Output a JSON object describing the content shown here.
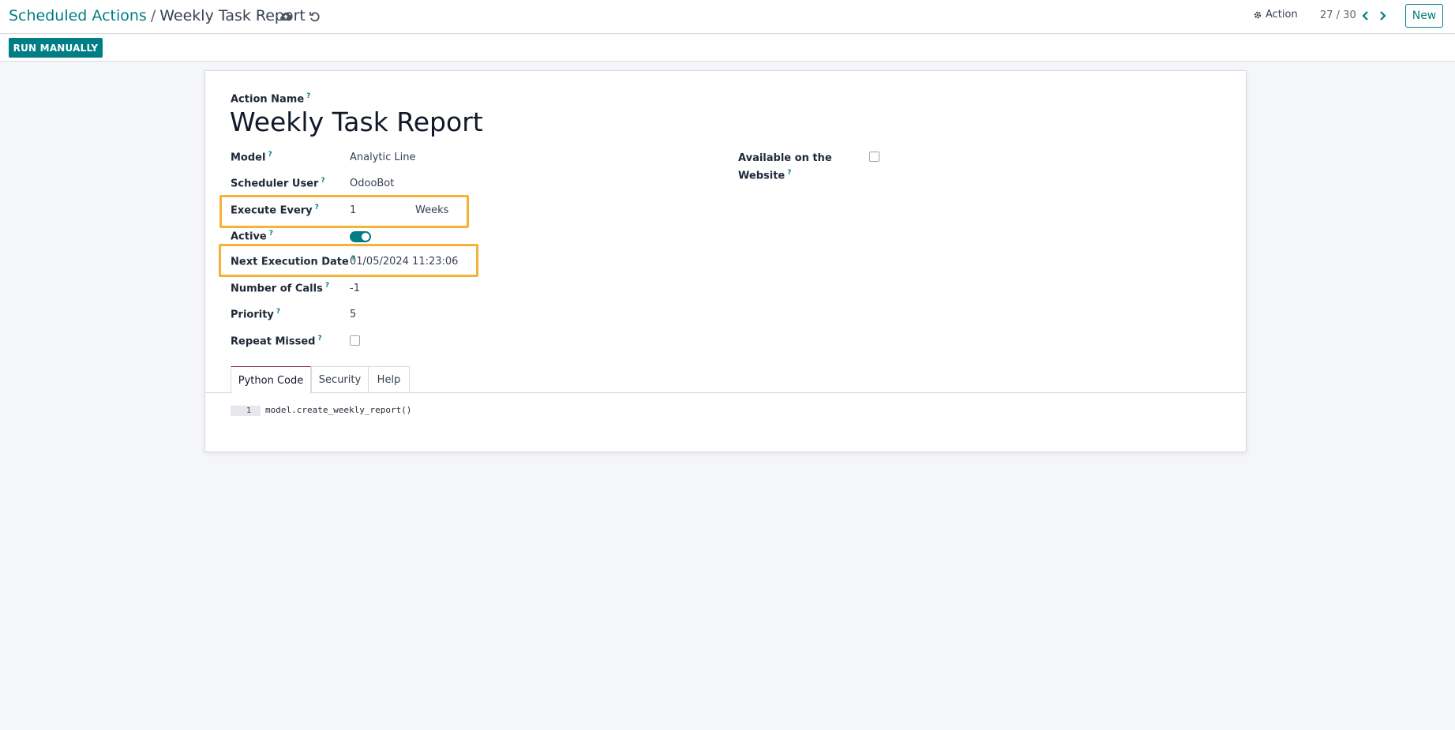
{
  "breadcrumb": {
    "parent": "Scheduled Actions",
    "separator": "/",
    "current": "Weekly Task Report"
  },
  "toolbar": {
    "save_icon": "cloud-upload-icon",
    "discard_icon": "undo-icon",
    "action_label": "Action",
    "action_icon": "gear-icon",
    "pager": "27 / 30",
    "new_label": "New"
  },
  "statusbar": {
    "run_label": "RUN MANUALLY"
  },
  "form": {
    "action_name_label": "Action Name",
    "title": "Weekly Task Report",
    "fields": {
      "model": {
        "label": "Model",
        "value": "Analytic Line"
      },
      "scheduler_user": {
        "label": "Scheduler User",
        "value": "OdooBot"
      },
      "execute_every": {
        "label": "Execute Every",
        "value": "1",
        "unit": "Weeks"
      },
      "active": {
        "label": "Active",
        "value": true
      },
      "next_execution_date": {
        "label": "Next Execution Date",
        "value": "01/05/2024 11:23:06"
      },
      "number_of_calls": {
        "label": "Number of Calls",
        "value": "-1"
      },
      "priority": {
        "label": "Priority",
        "value": "5"
      },
      "repeat_missed": {
        "label": "Repeat Missed",
        "value": false
      },
      "available_on_website": {
        "label_line1": "Available on the",
        "label_line2": "Website",
        "value": false
      }
    },
    "help_marker": "?",
    "tabs": [
      {
        "label": "Python Code",
        "active": true
      },
      {
        "label": "Security",
        "active": false
      },
      {
        "label": "Help",
        "active": false
      }
    ],
    "code": {
      "line_number": "1",
      "text": "model.create_weekly_report()"
    }
  },
  "colors": {
    "brand": "#017e84",
    "highlight": "#f5b335",
    "active_tab": "#8c3a4b"
  }
}
